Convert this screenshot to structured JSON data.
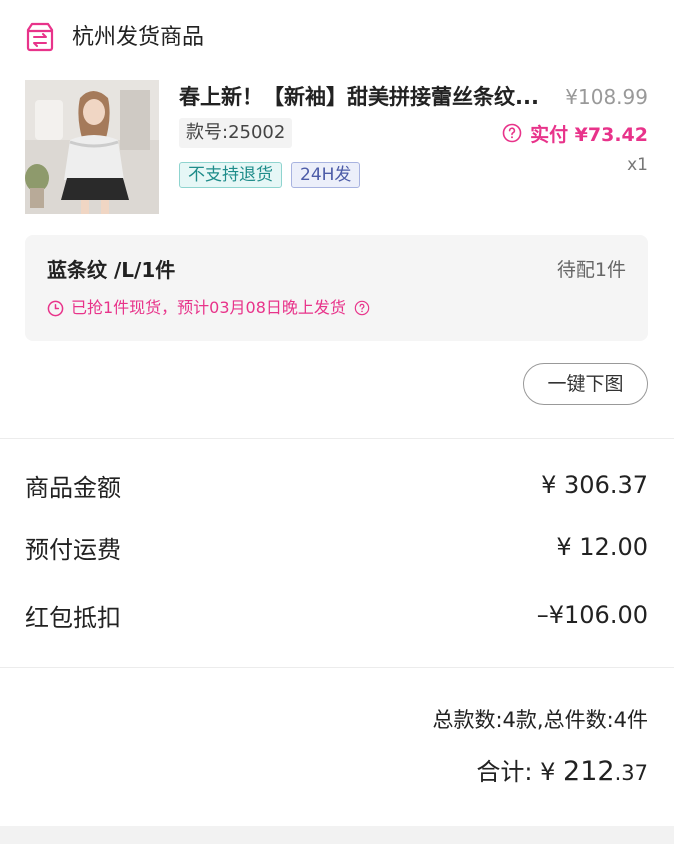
{
  "store": {
    "title": "杭州发货商品",
    "icon": "store-transfer-icon"
  },
  "product": {
    "title": "春上新！【新袖】甜美拼接蕾丝条纹...",
    "price": "¥108.99",
    "sku": "款号:25002",
    "paid_label": "实付 ¥73.42",
    "quantity": "x1",
    "badges": [
      "不支持退货",
      "24H发"
    ]
  },
  "variant": {
    "label": "蓝条纹 /L/1件",
    "status": "待配1件",
    "notice": "已抢1件现货，预计03月08日晚上发货"
  },
  "actions": {
    "download_label": "一键下图"
  },
  "summary": {
    "rows": [
      {
        "label": "商品金额",
        "value": "¥ 306.37"
      },
      {
        "label": "预付运费",
        "value": "¥ 12.00"
      },
      {
        "label": "红包抵扣",
        "value": "–¥106.00"
      }
    ],
    "counts": "总款数:4款,总件数:4件",
    "total_label": "合计:",
    "total_currency": "¥",
    "total_int": "212",
    "total_dec": ".37"
  },
  "colors": {
    "accent": "#e8338a",
    "teal_badge": "#1f8c8a",
    "blue_badge": "#4d5ca8"
  }
}
